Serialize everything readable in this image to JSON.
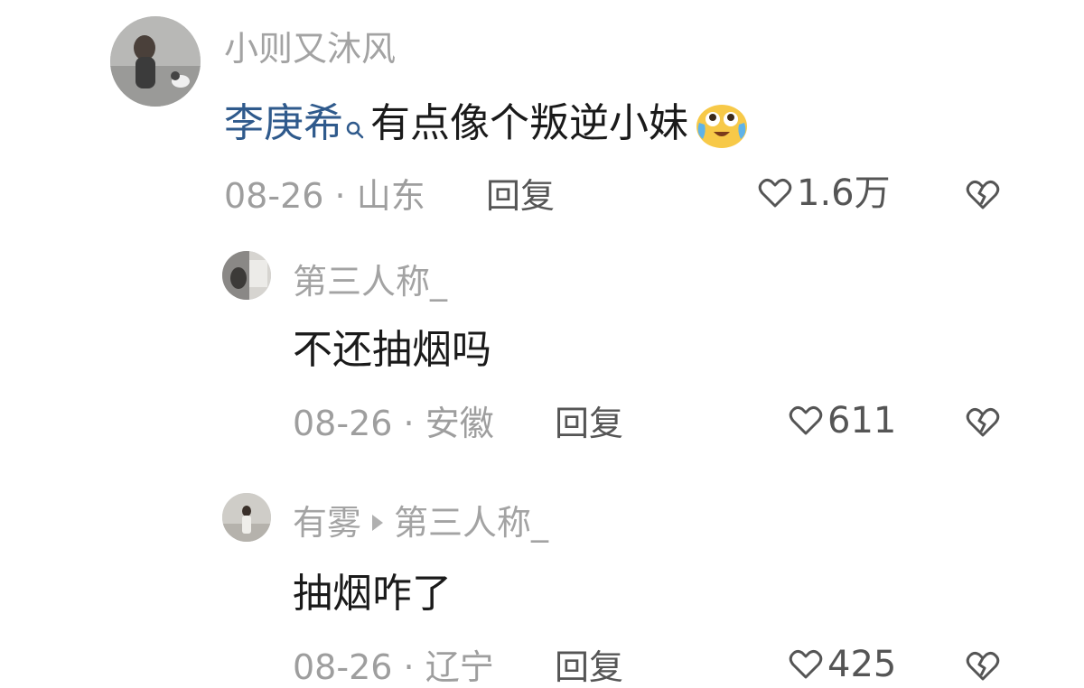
{
  "comments": [
    {
      "username": "小则又沐风",
      "mention": "李庚希",
      "text": "有点像个叛逆小妹",
      "emoji": "grinning-tears-emoji",
      "date": "08-26",
      "separator": "·",
      "location": "山东",
      "reply_label": "回复",
      "likes": "1.6万"
    },
    {
      "username": "第三人称_",
      "text": "不还抽烟吗",
      "date": "08-26",
      "separator": "·",
      "location": "安徽",
      "reply_label": "回复",
      "likes": "611"
    },
    {
      "username": "有雾",
      "reply_to": "第三人称_",
      "text": "抽烟咋了",
      "date": "08-26",
      "separator": "·",
      "location": "辽宁",
      "reply_label": "回复",
      "likes": "425"
    }
  ],
  "colors": {
    "mention": "#2f5a8c",
    "username": "#a3a3a3",
    "meta": "#9e9e9e",
    "text": "#1a1a1a"
  }
}
